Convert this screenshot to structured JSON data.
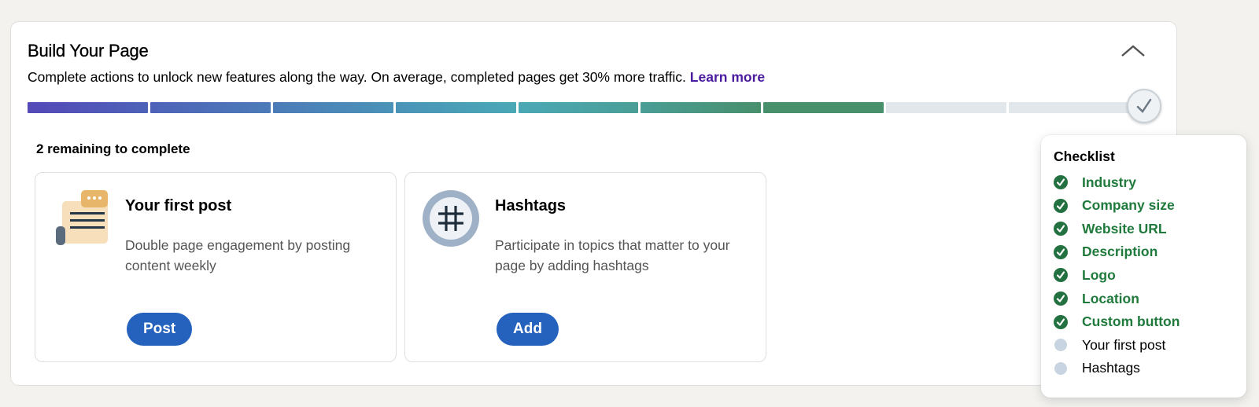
{
  "header": {
    "title": "Build Your Page",
    "subtitle": "Complete actions to unlock new features along the way. On average, completed pages get 30% more traffic.",
    "learn_more": "Learn more",
    "collapse_icon": "chevron-up-icon"
  },
  "progress": {
    "total_steps": 9,
    "completed_steps": 7,
    "fraction_complete": 0.78,
    "segment_colors": [
      "#5449b8",
      "#4e62b8",
      "#4c7bb8",
      "#4a93b8",
      "#4aa8b5",
      "#4a9e96",
      "#488f6c"
    ],
    "empty_color": "#e1e7ea",
    "end_icon": "checkmark-icon"
  },
  "remaining_label": "2 remaining to complete",
  "tasks": [
    {
      "title": "Your first post",
      "description": "Double page engagement by posting content weekly",
      "button": "Post",
      "icon": "document-post-icon"
    },
    {
      "title": "Hashtags",
      "description": "Participate in topics that matter to your page by adding hashtags",
      "button": "Add",
      "icon": "hashtag-icon"
    }
  ],
  "checklist": {
    "title": "Checklist",
    "items": [
      {
        "label": "Industry",
        "done": true
      },
      {
        "label": "Company size",
        "done": true
      },
      {
        "label": "Website URL",
        "done": true
      },
      {
        "label": "Description",
        "done": true
      },
      {
        "label": "Logo",
        "done": true
      },
      {
        "label": "Location",
        "done": true
      },
      {
        "label": "Custom button",
        "done": true
      },
      {
        "label": "Your first post",
        "done": false
      },
      {
        "label": "Hashtags",
        "done": false
      }
    ]
  }
}
